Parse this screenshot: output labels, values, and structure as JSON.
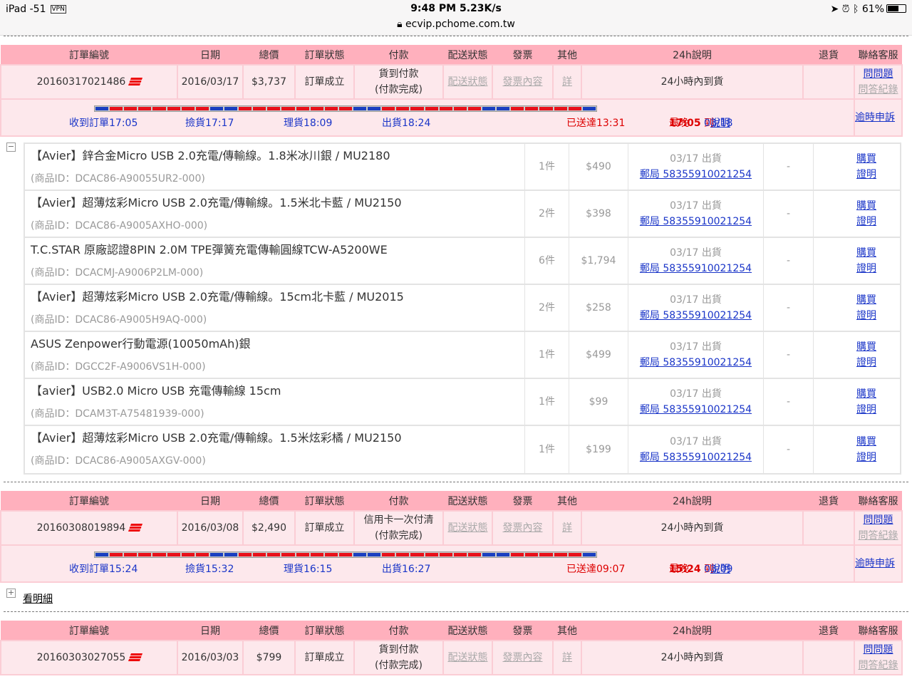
{
  "status": {
    "left": "iPad -51",
    "vpn": "VPN",
    "center": "9:48 PM 5.23K/s",
    "url": "ecvip.pchome.com.tw",
    "battery": "61%"
  },
  "headers": [
    "訂單編號",
    "日期",
    "總價",
    "訂單狀態",
    "付款",
    "配送狀態",
    "發票",
    "其他",
    "24h說明",
    "退貨",
    "聯絡客服"
  ],
  "labels": {
    "ship_status": "配送狀態",
    "invoice": "發票內容",
    "other": "詳",
    "ask": "問問題",
    "qa_log": "問答紀錄",
    "complain": "逾時申訴",
    "explain": "說明",
    "latest": "最晚",
    "to": "到",
    "details": "看明細",
    "pay_done": "(付款完成)",
    "established": "訂單成立",
    "h24": "24小時內到貨"
  },
  "orders": [
    {
      "id": "20160317021486",
      "date": "2016/03/17",
      "total": "$3,737",
      "payment": "貨到付款",
      "received": "收到訂單17:05",
      "picked": "撿貨17:17",
      "sorted": "理貨18:09",
      "shipped": "出貨18:24",
      "delivered": "已送達13:31",
      "latest_time": "17:05",
      "latest_date": "03/18",
      "items": [
        {
          "name": "【Avier】鋅合金Micro USB 2.0充電/傳輸線。1.8米冰川銀 / MU2180",
          "pid": "(商品ID：DCAC86-A90055UR2-000)",
          "qty": "1件",
          "price": "$490"
        },
        {
          "name": "【Avier】超薄炫彩Micro USB 2.0充電/傳輸線。1.5米北卡藍 / MU2150",
          "pid": "(商品ID：DCAC86-A9005AXHO-000)",
          "qty": "2件",
          "price": "$398"
        },
        {
          "name": "T.C.STAR 原廠認證8PIN 2.0M TPE彈簧充電傳輸圓線TCW-A5200WE",
          "pid": "(商品ID：DCACMJ-A9006P2LM-000)",
          "qty": "6件",
          "price": "$1,794"
        },
        {
          "name": "【Avier】超薄炫彩Micro USB 2.0充電/傳輸線。15cm北卡藍 / MU2015",
          "pid": "(商品ID：DCAC86-A9005H9AQ-000)",
          "qty": "2件",
          "price": "$258"
        },
        {
          "name": "ASUS Zenpower行動電源(10050mAh)銀",
          "pid": "(商品ID：DGCC2F-A9006VS1H-000)",
          "qty": "1件",
          "price": "$499"
        },
        {
          "name": "【avier】USB2.0 Micro USB 充電傳輸線 15cm",
          "pid": "(商品ID：DCAM3T-A75481939-000)",
          "qty": "1件",
          "price": "$99"
        },
        {
          "name": "【Avier】超薄炫彩Micro USB 2.0充電/傳輸線。1.5米炫彩橘 / MU2150",
          "pid": "(商品ID：DCAC86-A9005AXGV-000)",
          "qty": "1件",
          "price": "$199"
        }
      ],
      "ship_date": "03/17 出貨",
      "tracking": "郵局 58355910021254",
      "ret": "-",
      "buy": "購買",
      "proof": "證明"
    },
    {
      "id": "20160308019894",
      "date": "2016/03/08",
      "total": "$2,490",
      "payment": "信用卡一次付清",
      "received": "收到訂單15:24",
      "picked": "撿貨15:32",
      "sorted": "理貨16:15",
      "shipped": "出貨16:27",
      "delivered": "已送達09:07",
      "latest_time": "15:24",
      "latest_date": "03/09"
    },
    {
      "id": "20160303027055",
      "date": "2016/03/03",
      "total": "$799",
      "payment": "貨到付款"
    }
  ]
}
